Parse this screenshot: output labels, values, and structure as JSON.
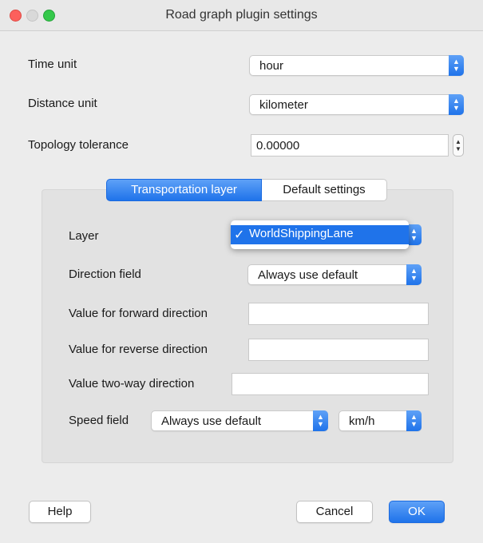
{
  "window": {
    "title": "Road graph plugin settings"
  },
  "general": {
    "time_unit_label": "Time unit",
    "time_unit_value": "hour",
    "distance_unit_label": "Distance unit",
    "distance_unit_value": "kilometer",
    "topology_tolerance_label": "Topology tolerance",
    "topology_tolerance_value": "0.00000"
  },
  "tabs": {
    "transportation_layer": "Transportation layer",
    "default_settings": "Default settings"
  },
  "transport": {
    "layer_label": "Layer",
    "layer_value": "WorldShippingLane",
    "layer_check": "✓",
    "direction_field_label": "Direction field",
    "direction_field_value": "Always use default",
    "forward_label": "Value for forward direction",
    "forward_value": "",
    "reverse_label": "Value for reverse direction",
    "reverse_value": "",
    "twoway_label": "Value two-way direction",
    "twoway_value": "",
    "speed_field_label": "Speed field",
    "speed_field_value": "Always use default",
    "speed_unit_value": "km/h"
  },
  "buttons": {
    "help": "Help",
    "cancel": "Cancel",
    "ok": "OK"
  },
  "colors": {
    "accent": "#1f73ea",
    "background": "#ececec",
    "group": "#e2e2e2"
  }
}
